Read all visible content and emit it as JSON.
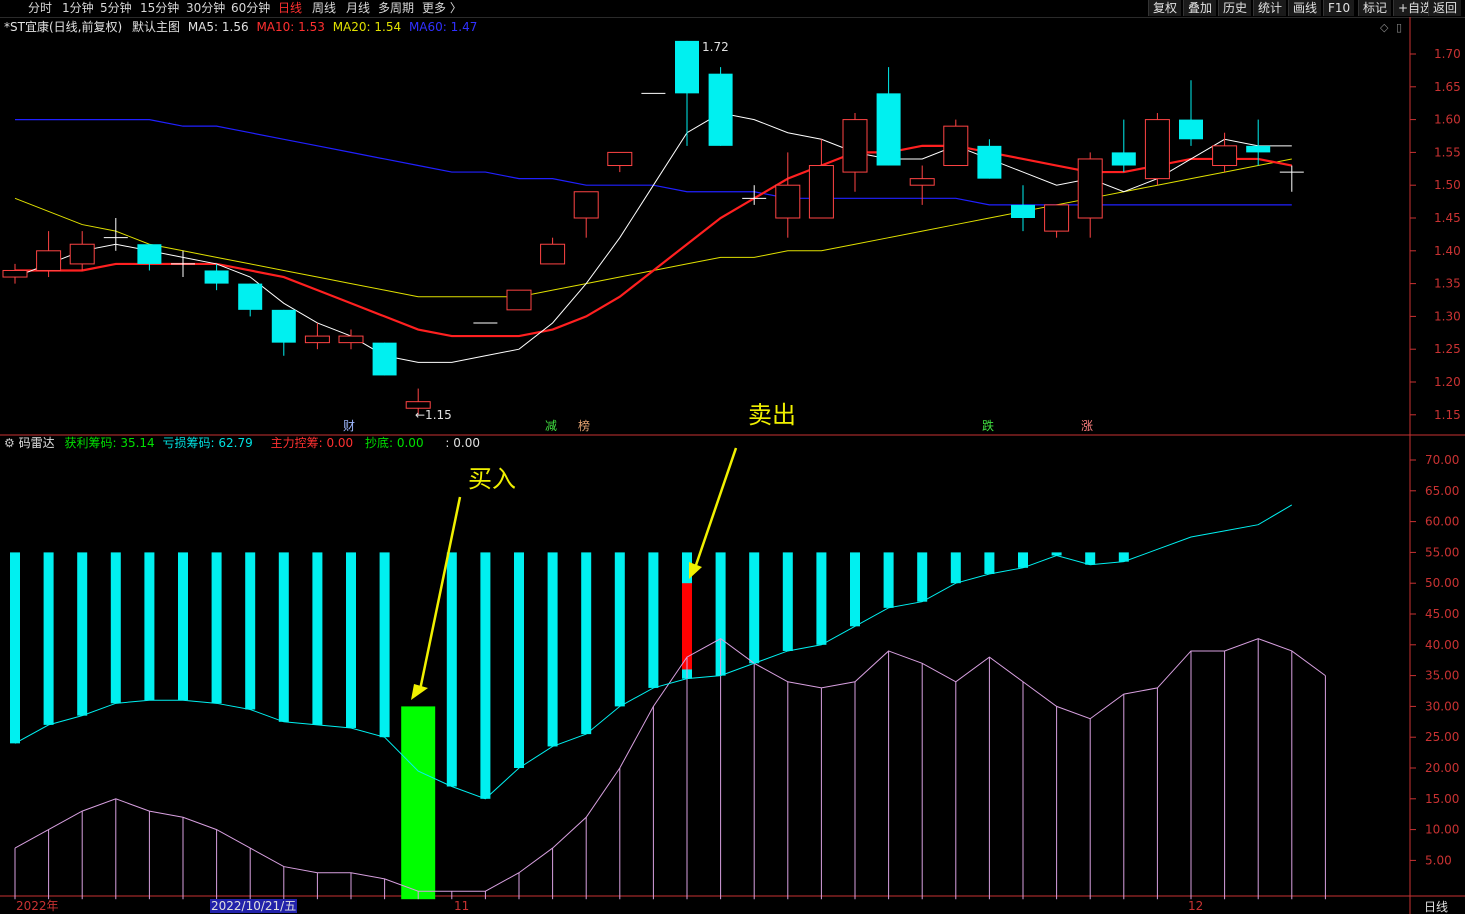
{
  "topbar": {
    "periods": [
      "分时",
      "1分钟",
      "5分钟",
      "15分钟",
      "30分钟",
      "60分钟",
      "日线",
      "周线",
      "月线",
      "多周期",
      "更多 〉"
    ],
    "active_period": "日线",
    "buttons": [
      "复权",
      "叠加",
      "历史",
      "统计",
      "画线",
      "F10",
      "标记",
      "+自选",
      "返回"
    ]
  },
  "main_info": {
    "stock": "*ST宜康(日线,前复权)",
    "template": "默认主图",
    "ma5_label": "MA5:",
    "ma5_value": "1.56",
    "ma10_label": "MA10:",
    "ma10_value": "1.53",
    "ma20_label": "MA20:",
    "ma20_value": "1.54",
    "ma60_label": "MA60:",
    "ma60_value": "1.47"
  },
  "sub_info": {
    "name": "码雷达",
    "profit_label": "获利筹码:",
    "profit_value": "35.14",
    "loss_label": "亏损筹码:",
    "loss_value": "62.79",
    "control_label": "主力控筹:",
    "control_value": "0.00",
    "bottom_label": "抄底:",
    "bottom_value": "0.00",
    "extra_label": ":",
    "extra_value": "0.00"
  },
  "annotations": {
    "buy": "买入",
    "sell": "卖出",
    "high_mark": "1.72",
    "low_mark": "←1.15"
  },
  "markers": [
    "财",
    "减",
    "榜",
    "跌",
    "涨"
  ],
  "date_axis": {
    "start": "2022年",
    "cursor": "2022/10/21/五",
    "nov": "11",
    "dec": "12"
  },
  "period_label": "日线",
  "colors": {
    "up": "#ff4444",
    "down": "#00f0f0",
    "ma5": "#ffffff",
    "ma10": "#ff2020",
    "ma20": "#e0e000",
    "ma60": "#2020ff",
    "axis": "#c83232",
    "buy_bar": "#00ff00",
    "sell_bar": "#ff0000"
  },
  "chart_data": [
    {
      "type": "candlestick",
      "yticks": [
        1.15,
        1.2,
        1.25,
        1.3,
        1.35,
        1.4,
        1.45,
        1.5,
        1.55,
        1.6,
        1.65,
        1.7
      ],
      "ylim": [
        1.1,
        1.74
      ],
      "candles": [
        [
          1.36,
          1.37,
          1.38,
          1.35
        ],
        [
          1.37,
          1.4,
          1.43,
          1.36
        ],
        [
          1.38,
          1.41,
          1.43,
          1.37
        ],
        [
          1.42,
          1.42,
          1.45,
          1.4
        ],
        [
          1.41,
          1.38,
          1.41,
          1.37
        ],
        [
          1.38,
          1.38,
          1.4,
          1.36
        ],
        [
          1.37,
          1.35,
          1.38,
          1.34
        ],
        [
          1.35,
          1.31,
          1.35,
          1.3
        ],
        [
          1.31,
          1.26,
          1.31,
          1.24
        ],
        [
          1.26,
          1.27,
          1.29,
          1.25
        ],
        [
          1.26,
          1.27,
          1.28,
          1.25
        ],
        [
          1.26,
          1.21,
          1.26,
          1.21
        ],
        [
          1.16,
          1.17,
          1.19,
          1.15
        ],
        [
          null,
          null,
          null,
          null
        ],
        [
          1.29,
          1.29,
          1.29,
          1.29
        ],
        [
          1.31,
          1.34,
          1.34,
          1.31
        ],
        [
          1.38,
          1.41,
          1.42,
          1.38
        ],
        [
          1.45,
          1.49,
          1.49,
          1.42
        ],
        [
          1.53,
          1.55,
          1.55,
          1.52
        ],
        [
          1.64,
          1.64,
          1.64,
          1.64
        ],
        [
          1.72,
          1.64,
          1.72,
          1.56
        ],
        [
          1.67,
          1.56,
          1.68,
          1.56
        ],
        [
          1.48,
          1.48,
          1.5,
          1.47
        ],
        [
          1.45,
          1.5,
          1.55,
          1.42
        ],
        [
          1.45,
          1.53,
          1.57,
          1.45
        ],
        [
          1.52,
          1.6,
          1.61,
          1.49
        ],
        [
          1.64,
          1.53,
          1.68,
          1.53
        ],
        [
          1.5,
          1.51,
          1.53,
          1.47
        ],
        [
          1.53,
          1.59,
          1.6,
          1.53
        ],
        [
          1.56,
          1.51,
          1.57,
          1.51
        ],
        [
          1.47,
          1.45,
          1.5,
          1.43
        ],
        [
          1.43,
          1.47,
          1.47,
          1.42
        ],
        [
          1.45,
          1.54,
          1.55,
          1.42
        ],
        [
          1.55,
          1.53,
          1.6,
          1.52
        ],
        [
          1.51,
          1.6,
          1.61,
          1.5
        ],
        [
          1.6,
          1.57,
          1.66,
          1.56
        ],
        [
          1.53,
          1.56,
          1.58,
          1.52
        ],
        [
          1.56,
          1.55,
          1.6,
          1.53
        ],
        [
          1.52,
          1.52,
          1.53,
          1.49
        ]
      ],
      "ma5": [
        1.36,
        1.38,
        1.4,
        1.41,
        1.4,
        1.39,
        1.38,
        1.36,
        1.32,
        1.29,
        1.27,
        1.24,
        1.23,
        1.23,
        1.24,
        1.25,
        1.29,
        1.35,
        1.42,
        1.5,
        1.58,
        1.61,
        1.6,
        1.58,
        1.57,
        1.55,
        1.54,
        1.54,
        1.56,
        1.54,
        1.52,
        1.5,
        1.51,
        1.49,
        1.51,
        1.54,
        1.57,
        1.56,
        1.56
      ],
      "ma10": [
        1.37,
        1.37,
        1.37,
        1.38,
        1.38,
        1.38,
        1.38,
        1.37,
        1.36,
        1.34,
        1.32,
        1.3,
        1.28,
        1.27,
        1.27,
        1.27,
        1.28,
        1.3,
        1.33,
        1.37,
        1.41,
        1.45,
        1.48,
        1.51,
        1.53,
        1.55,
        1.55,
        1.56,
        1.56,
        1.55,
        1.54,
        1.53,
        1.52,
        1.52,
        1.53,
        1.54,
        1.54,
        1.54,
        1.53
      ],
      "ma20": [
        1.48,
        1.46,
        1.44,
        1.43,
        1.41,
        1.4,
        1.39,
        1.38,
        1.37,
        1.36,
        1.35,
        1.34,
        1.33,
        1.33,
        1.33,
        1.33,
        1.34,
        1.35,
        1.36,
        1.37,
        1.38,
        1.39,
        1.39,
        1.4,
        1.4,
        1.41,
        1.42,
        1.43,
        1.44,
        1.45,
        1.46,
        1.47,
        1.48,
        1.49,
        1.5,
        1.51,
        1.52,
        1.53,
        1.54
      ],
      "ma60": [
        1.6,
        1.6,
        1.6,
        1.6,
        1.6,
        1.59,
        1.59,
        1.58,
        1.57,
        1.56,
        1.55,
        1.54,
        1.53,
        1.52,
        1.52,
        1.51,
        1.51,
        1.5,
        1.5,
        1.5,
        1.49,
        1.49,
        1.49,
        1.48,
        1.48,
        1.48,
        1.48,
        1.48,
        1.48,
        1.47,
        1.47,
        1.47,
        1.47,
        1.47,
        1.47,
        1.47,
        1.47,
        1.47,
        1.47
      ]
    },
    {
      "type": "bar",
      "yticks": [
        5,
        10,
        15,
        20,
        25,
        30,
        35,
        40,
        45,
        50,
        55,
        60,
        65,
        70
      ],
      "ylim": [
        0,
        72
      ],
      "profit_line": [
        24,
        27,
        28.5,
        30.5,
        31,
        31,
        30.5,
        29.5,
        27.5,
        27,
        26.5,
        25,
        19.5,
        17,
        15,
        20,
        23.5,
        25.5,
        30,
        33,
        34.5,
        35,
        37,
        39,
        40,
        43,
        46,
        47,
        50,
        51.5,
        52.5,
        54.5,
        53,
        53.5,
        55.5,
        57.5,
        58.5,
        59.5,
        62.7
      ],
      "loss_line": [
        7,
        10,
        13,
        15,
        13,
        12,
        10,
        7,
        4,
        3,
        3,
        2,
        0,
        0,
        0,
        3,
        7,
        12,
        20,
        30,
        38,
        41,
        37,
        34,
        33,
        34,
        39,
        37,
        34,
        38,
        34,
        30,
        28,
        32,
        33,
        39,
        39,
        41,
        39,
        35
      ],
      "buy_bar": {
        "index": 12,
        "value": 30
      },
      "sell_bar": {
        "index": 20,
        "low": 36,
        "high": 50
      }
    }
  ]
}
